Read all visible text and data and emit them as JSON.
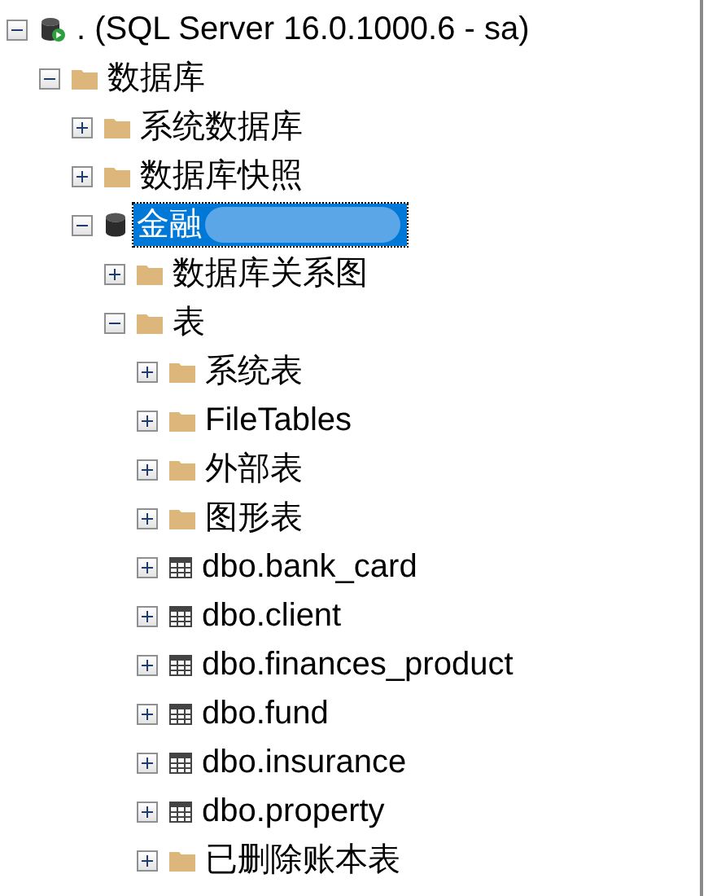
{
  "tree": [
    {
      "kind": "server",
      "label": ". (SQL Server 16.0.1000.6 - sa)",
      "expanded": true,
      "selected": false,
      "children": [
        {
          "kind": "folder",
          "label": "数据库",
          "expanded": true,
          "selected": false,
          "children": [
            {
              "kind": "folder",
              "label": "系统数据库",
              "expanded": false,
              "selected": false
            },
            {
              "kind": "folder",
              "label": "数据库快照",
              "expanded": false,
              "selected": false
            },
            {
              "kind": "database",
              "label": "金融",
              "expanded": true,
              "selected": true,
              "children": [
                {
                  "kind": "folder",
                  "label": "数据库关系图",
                  "expanded": false,
                  "selected": false
                },
                {
                  "kind": "folder",
                  "label": "表",
                  "expanded": true,
                  "selected": false,
                  "children": [
                    {
                      "kind": "folder",
                      "label": "系统表",
                      "expanded": false,
                      "selected": false
                    },
                    {
                      "kind": "folder",
                      "label": "FileTables",
                      "expanded": false,
                      "selected": false
                    },
                    {
                      "kind": "folder",
                      "label": "外部表",
                      "expanded": false,
                      "selected": false
                    },
                    {
                      "kind": "folder",
                      "label": "图形表",
                      "expanded": false,
                      "selected": false
                    },
                    {
                      "kind": "table",
                      "label": "dbo.bank_card",
                      "expanded": false,
                      "selected": false
                    },
                    {
                      "kind": "table",
                      "label": "dbo.client",
                      "expanded": false,
                      "selected": false
                    },
                    {
                      "kind": "table",
                      "label": "dbo.finances_product",
                      "expanded": false,
                      "selected": false
                    },
                    {
                      "kind": "table",
                      "label": "dbo.fund",
                      "expanded": false,
                      "selected": false
                    },
                    {
                      "kind": "table",
                      "label": "dbo.insurance",
                      "expanded": false,
                      "selected": false
                    },
                    {
                      "kind": "table",
                      "label": "dbo.property",
                      "expanded": false,
                      "selected": false
                    },
                    {
                      "kind": "folder",
                      "label": "已删除账本表",
                      "expanded": false,
                      "selected": false
                    }
                  ]
                }
              ]
            }
          ]
        }
      ]
    }
  ]
}
